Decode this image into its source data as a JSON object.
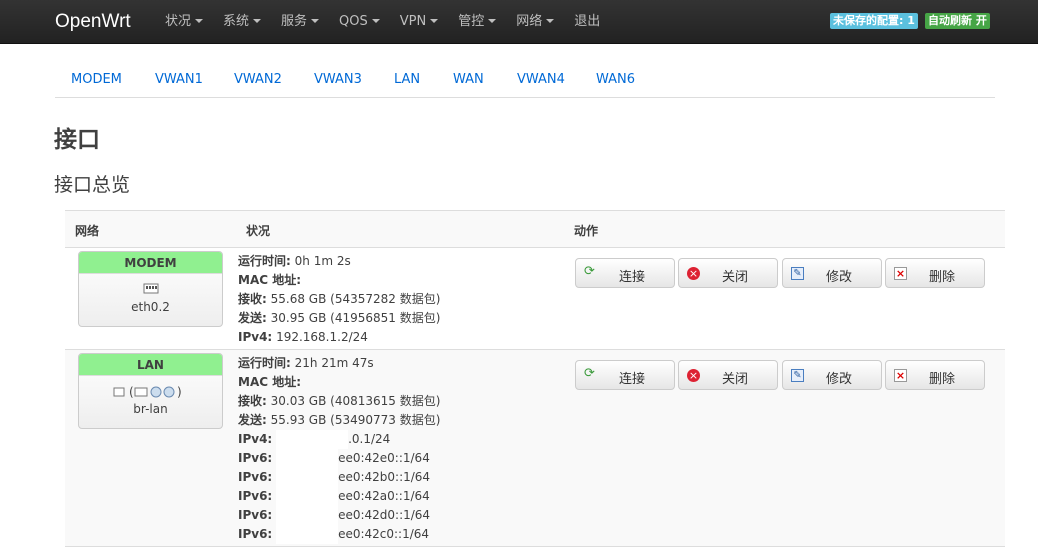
{
  "navbar": {
    "brand": "OpenWrt",
    "menu": [
      "状况",
      "系统",
      "服务",
      "QOS",
      "VPN",
      "管控",
      "网络"
    ],
    "logout": "退出",
    "unsaved": "未保存的配置: 1",
    "autorefresh": "自动刷新 开",
    "colors": {
      "unsaved": "#5bc0de",
      "autorefresh": "#46a546"
    }
  },
  "tabs": [
    "MODEM",
    "VWAN1",
    "VWAN2",
    "VWAN3",
    "LAN",
    "WAN",
    "VWAN4",
    "WAN6"
  ],
  "page": {
    "title": "接口",
    "subtitle": "接口总览"
  },
  "table": {
    "headers": [
      "网络",
      "状况",
      "动作"
    ],
    "rows": [
      {
        "name": "MODEM",
        "device": "eth0.2",
        "icon": "ethernet-port-icon",
        "uptime_label": "运行时间:",
        "uptime": "0h 1m 2s",
        "mac_label": "MAC 地址:",
        "mac": "",
        "rx_label": "接收:",
        "rx": "55.68 GB (54357282 数据包)",
        "tx_label": "发送:",
        "tx": "30.95 GB (41956851 数据包)",
        "ipv4_label": "IPv4:",
        "ipv4": "192.168.1.2/24"
      },
      {
        "name": "LAN",
        "device": "br-lan",
        "icon": "bridge-icon",
        "uptime_label": "运行时间:",
        "uptime": "21h 21m 47s",
        "mac_label": "MAC 地址:",
        "mac": "",
        "rx_label": "接收:",
        "rx": "30.03 GB (40813615 数据包)",
        "tx_label": "发送:",
        "tx": "55.93 GB (53490773 数据包)",
        "ipv4_label": "IPv4:",
        "ipv4": ".0.1/24",
        "ipv6_label": "IPv6:",
        "ipv6": [
          "ee0:42e0::1/64",
          "ee0:42b0::1/64",
          "ee0:42a0::1/64",
          "ee0:42d0::1/64",
          "ee0:42c0::1/64"
        ]
      }
    ],
    "actions": {
      "connect": "连接",
      "close": "关闭",
      "edit": "修改",
      "delete": "删除"
    }
  }
}
